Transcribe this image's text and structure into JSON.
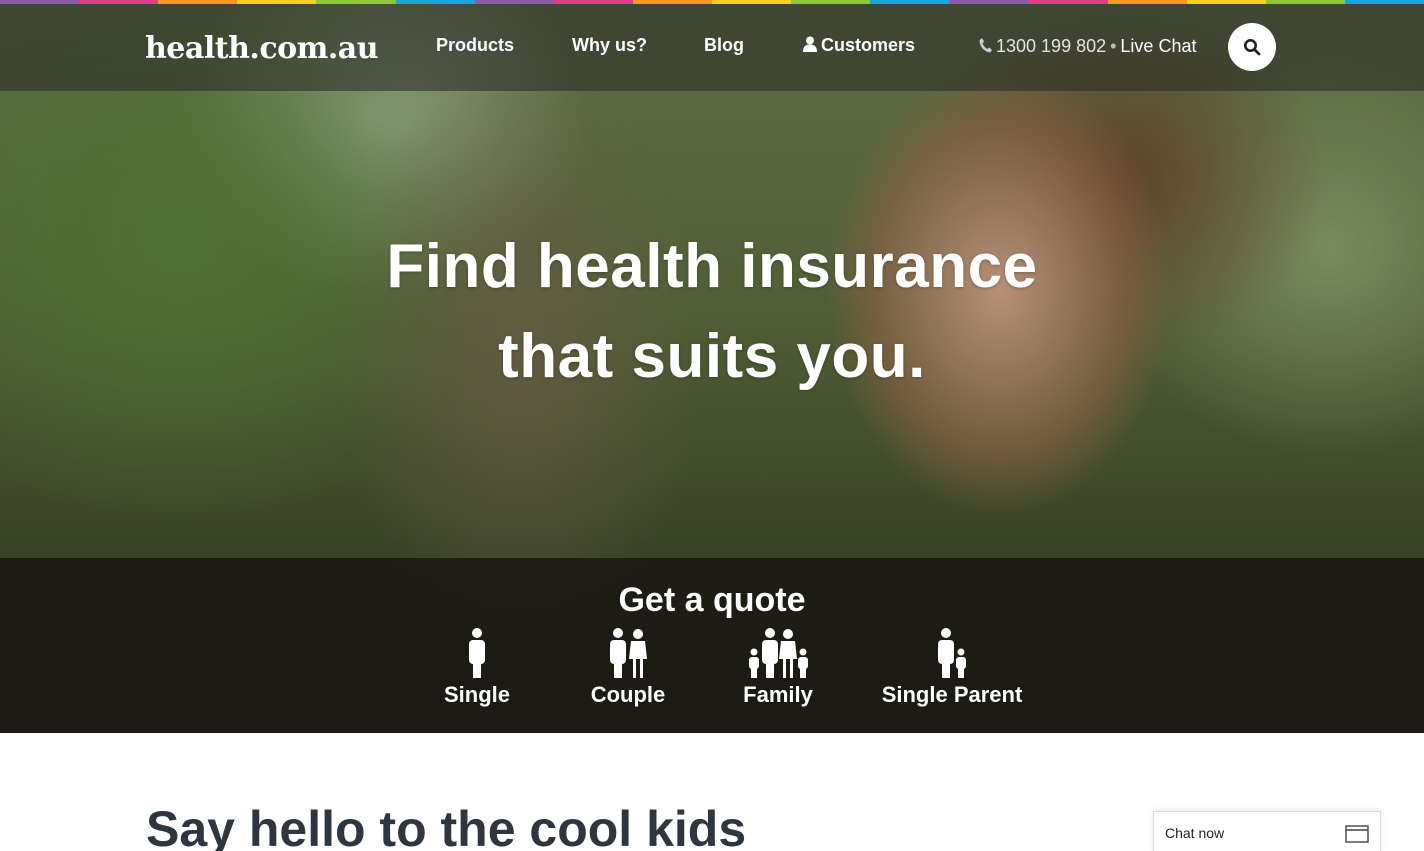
{
  "brand": {
    "logo_text": "health.com.au"
  },
  "rainbow_colors": [
    "#8e5aa7",
    "#e03d86",
    "#f39a1f",
    "#f6d01c",
    "#8dc63f",
    "#1ba6db",
    "#8e5aa7",
    "#e03d86",
    "#f39a1f",
    "#f6d01c",
    "#8dc63f",
    "#1ba6db",
    "#8e5aa7",
    "#e03d86",
    "#f39a1f",
    "#f6d01c",
    "#8dc63f",
    "#1ba6db"
  ],
  "nav": {
    "items": [
      {
        "label": "Products"
      },
      {
        "label": "Why us?"
      },
      {
        "label": "Blog"
      },
      {
        "label": "Customers",
        "icon": "user-icon"
      }
    ],
    "phone_icon": "phone-icon",
    "phone": "1300 199 802",
    "separator": "•",
    "live_chat": "Live Chat",
    "search_icon": "search-icon"
  },
  "hero": {
    "headline_line1": "Find health insurance",
    "headline_line2": "that suits you."
  },
  "quote": {
    "title": "Get a quote",
    "options": [
      {
        "label": "Single",
        "icon": "single-person-icon"
      },
      {
        "label": "Couple",
        "icon": "couple-icon"
      },
      {
        "label": "Family",
        "icon": "family-icon"
      },
      {
        "label": "Single Parent",
        "icon": "single-parent-icon"
      }
    ]
  },
  "section": {
    "title": "Say hello to the cool kids"
  },
  "chat_widget": {
    "label": "Chat now",
    "icon": "window-icon"
  }
}
